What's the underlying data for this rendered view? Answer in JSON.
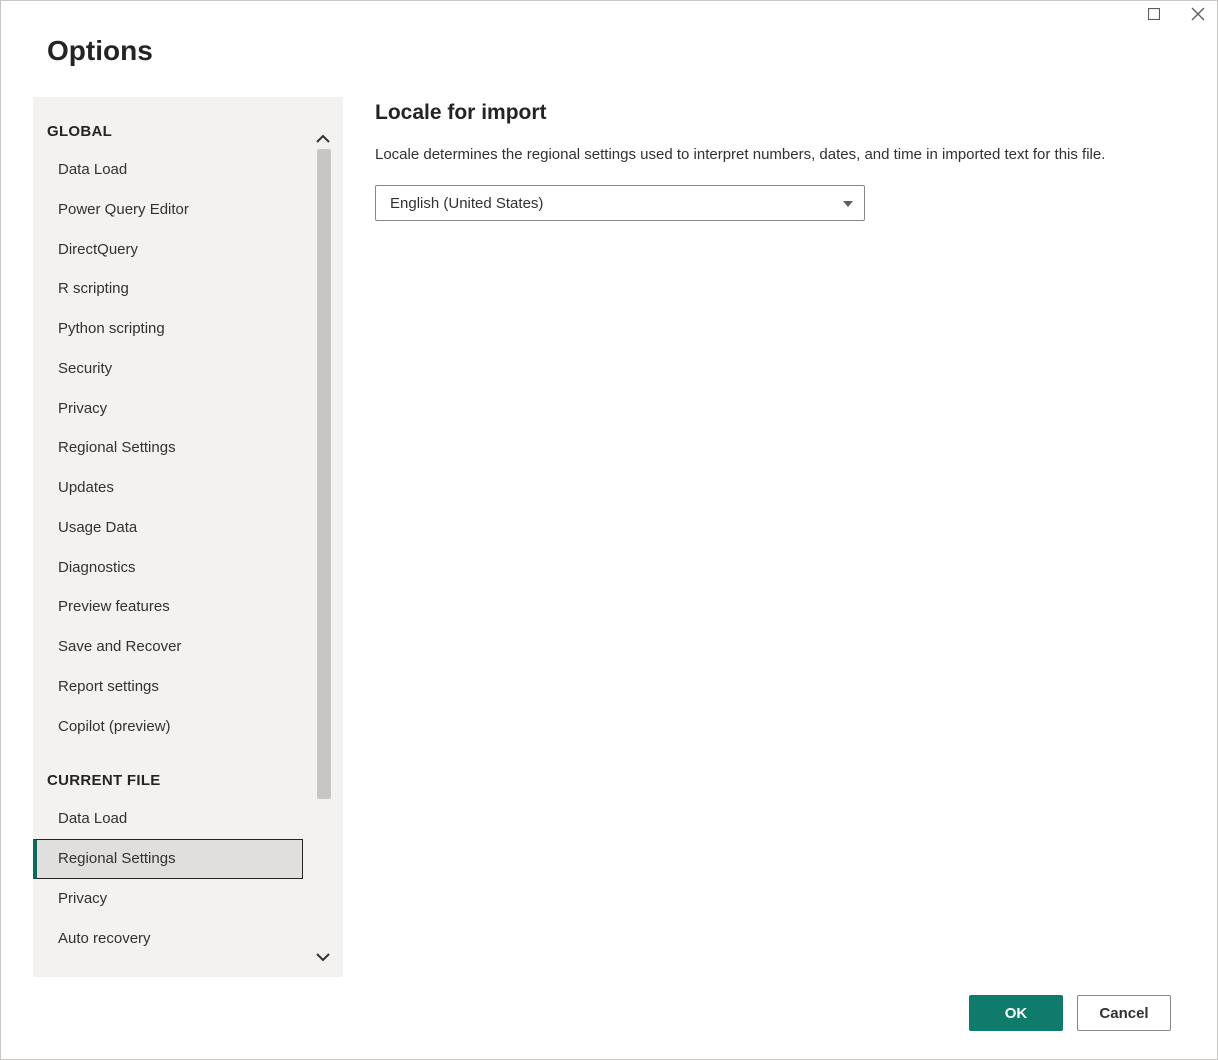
{
  "dialog": {
    "title": "Options"
  },
  "titlebar": {
    "maximize_label": "Maximize",
    "close_label": "Close"
  },
  "sidebar": {
    "sections": [
      {
        "header": "GLOBAL",
        "items": [
          {
            "label": "Data Load"
          },
          {
            "label": "Power Query Editor"
          },
          {
            "label": "DirectQuery"
          },
          {
            "label": "R scripting"
          },
          {
            "label": "Python scripting"
          },
          {
            "label": "Security"
          },
          {
            "label": "Privacy"
          },
          {
            "label": "Regional Settings"
          },
          {
            "label": "Updates"
          },
          {
            "label": "Usage Data"
          },
          {
            "label": "Diagnostics"
          },
          {
            "label": "Preview features"
          },
          {
            "label": "Save and Recover"
          },
          {
            "label": "Report settings"
          },
          {
            "label": "Copilot (preview)"
          }
        ]
      },
      {
        "header": "CURRENT FILE",
        "items": [
          {
            "label": "Data Load"
          },
          {
            "label": "Regional Settings",
            "selected": true
          },
          {
            "label": "Privacy"
          },
          {
            "label": "Auto recovery"
          }
        ]
      }
    ]
  },
  "content": {
    "heading": "Locale for import",
    "description": "Locale determines the regional settings used to interpret numbers, dates, and time in imported text for this file.",
    "locale_value": "English (United States)"
  },
  "footer": {
    "ok_label": "OK",
    "cancel_label": "Cancel"
  }
}
